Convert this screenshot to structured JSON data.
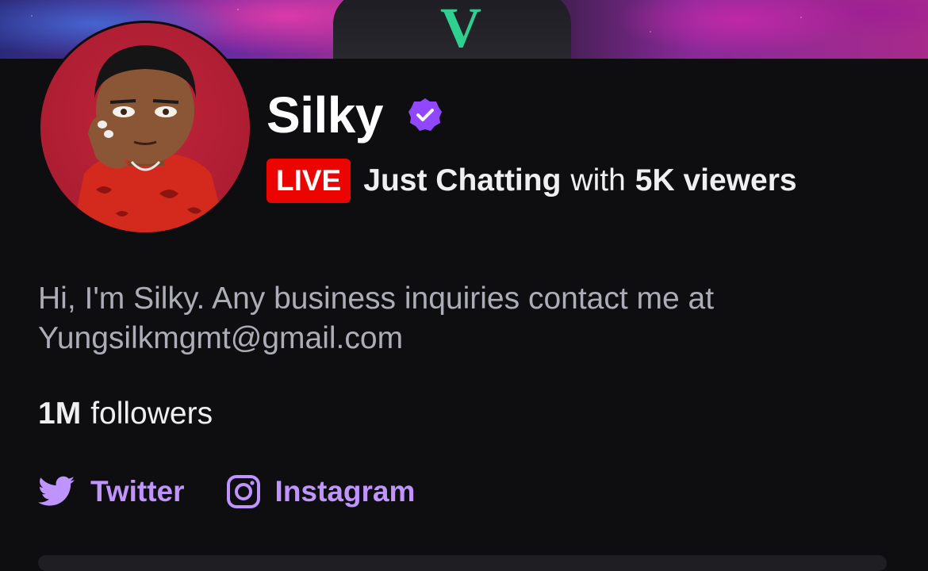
{
  "profile": {
    "name": "Silky",
    "status": {
      "live_label": "LIVE",
      "category": "Just Chatting",
      "with_text": "with",
      "viewers": "5K viewers"
    },
    "bio_line1": "Hi, I'm Silky. Any business inquiries contact me at",
    "bio_line2": "Yungsilkmgmt@gmail.com",
    "followers_count": "1M",
    "followers_label": "followers"
  },
  "links": [
    {
      "label": "Twitter",
      "icon": "twitter-icon"
    },
    {
      "label": "Instagram",
      "icon": "instagram-icon"
    }
  ],
  "colors": {
    "background": "#0e0e10",
    "accent": "#bf94ff",
    "verified": "#9147ff",
    "live": "#eb0400"
  }
}
